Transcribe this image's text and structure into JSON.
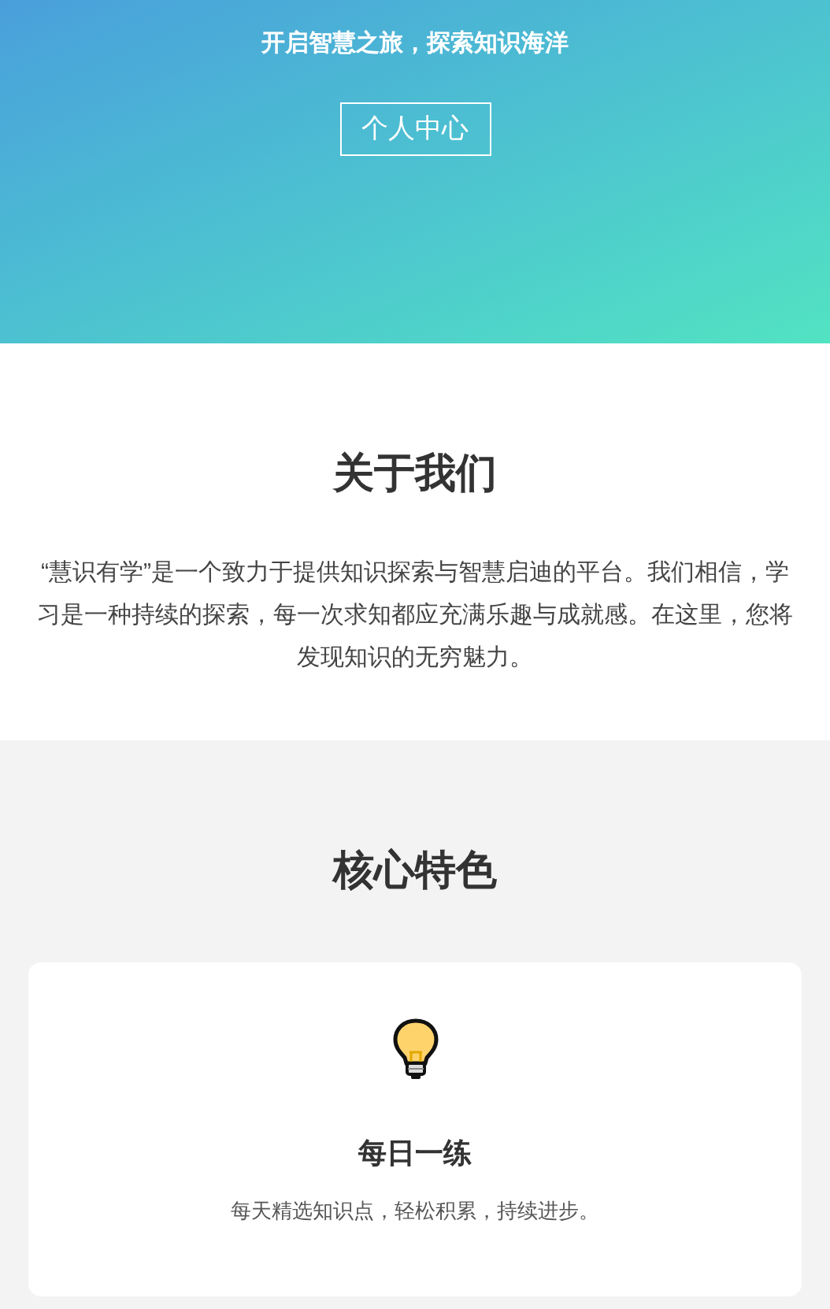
{
  "hero": {
    "subtitle": "开启智慧之旅，探索知识海洋",
    "button": "个人中心"
  },
  "about": {
    "title": "关于我们",
    "text": "“慧识有学”是一个致力于提供知识探索与智慧启迪的平台。我们相信，学习是一种持续的探索，每一次求知都应充满乐趣与成就感。在这里，您将发现知识的无穷魅力。"
  },
  "features": {
    "title": "核心特色",
    "cards": [
      {
        "title": "每日一练",
        "description": "每天精选知识点，轻松积累，持续进步。"
      }
    ]
  }
}
